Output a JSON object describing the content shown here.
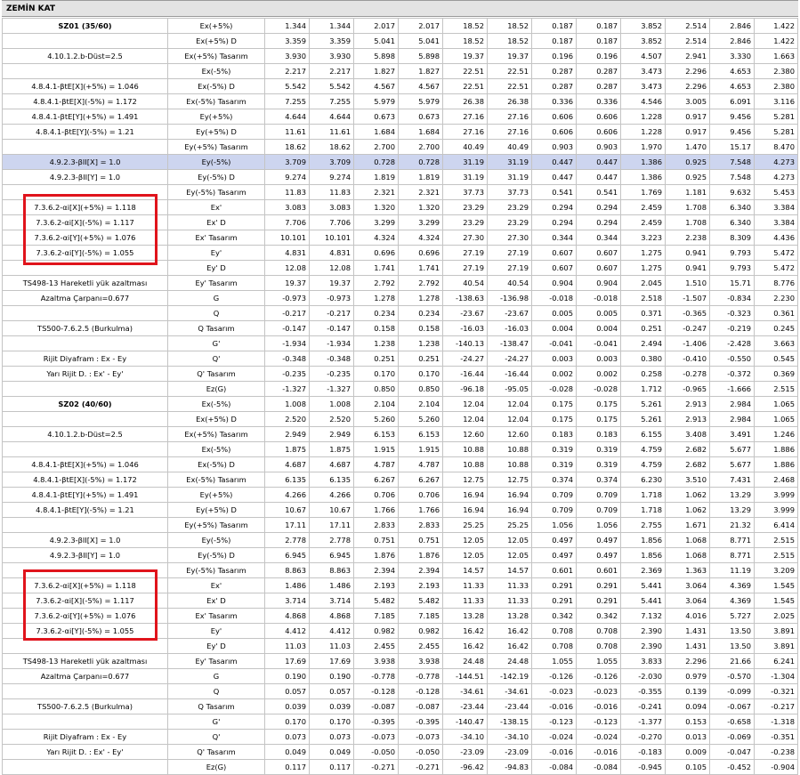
{
  "header": {
    "title": "ZEMİN KAT"
  },
  "rows": [
    {
      "label": "SZ01 (35/60)",
      "bold": true,
      "case": "Ex(+5%)",
      "v": [
        "1.344",
        "1.344",
        "2.017",
        "2.017",
        "18.52",
        "18.52",
        "0.187",
        "0.187",
        "3.852",
        "2.514",
        "2.846",
        "1.422"
      ]
    },
    {
      "label": "",
      "case": "Ex(+5%) D",
      "v": [
        "3.359",
        "3.359",
        "5.041",
        "5.041",
        "18.52",
        "18.52",
        "0.187",
        "0.187",
        "3.852",
        "2.514",
        "2.846",
        "1.422"
      ]
    },
    {
      "label": "4.10.1.2.b-Düst=2.5",
      "case": "Ex(+5%) Tasarım",
      "v": [
        "3.930",
        "3.930",
        "5.898",
        "5.898",
        "19.37",
        "19.37",
        "0.196",
        "0.196",
        "4.507",
        "2.941",
        "3.330",
        "1.663"
      ]
    },
    {
      "label": "",
      "case": "Ex(-5%)",
      "v": [
        "2.217",
        "2.217",
        "1.827",
        "1.827",
        "22.51",
        "22.51",
        "0.287",
        "0.287",
        "3.473",
        "2.296",
        "4.653",
        "2.380"
      ]
    },
    {
      "label": "4.8.4.1-βtE[X](+5%) = 1.046",
      "case": "Ex(-5%) D",
      "v": [
        "5.542",
        "5.542",
        "4.567",
        "4.567",
        "22.51",
        "22.51",
        "0.287",
        "0.287",
        "3.473",
        "2.296",
        "4.653",
        "2.380"
      ]
    },
    {
      "label": "4.8.4.1-βtE[X](-5%) = 1.172",
      "case": "Ex(-5%) Tasarım",
      "v": [
        "7.255",
        "7.255",
        "5.979",
        "5.979",
        "26.38",
        "26.38",
        "0.336",
        "0.336",
        "4.546",
        "3.005",
        "6.091",
        "3.116"
      ]
    },
    {
      "label": "4.8.4.1-βtE[Y](+5%) = 1.491",
      "case": "Ey(+5%)",
      "v": [
        "4.644",
        "4.644",
        "0.673",
        "0.673",
        "27.16",
        "27.16",
        "0.606",
        "0.606",
        "1.228",
        "0.917",
        "9.456",
        "5.281"
      ]
    },
    {
      "label": "4.8.4.1-βtE[Y](-5%) = 1.21",
      "case": "Ey(+5%) D",
      "v": [
        "11.61",
        "11.61",
        "1.684",
        "1.684",
        "27.16",
        "27.16",
        "0.606",
        "0.606",
        "1.228",
        "0.917",
        "9.456",
        "5.281"
      ]
    },
    {
      "label": "",
      "case": "Ey(+5%) Tasarım",
      "v": [
        "18.62",
        "18.62",
        "2.700",
        "2.700",
        "40.49",
        "40.49",
        "0.903",
        "0.903",
        "1.970",
        "1.470",
        "15.17",
        "8.470"
      ]
    },
    {
      "label": "4.9.2.3-βII[X] = 1.0",
      "hl": true,
      "case": "Ey(-5%)",
      "v": [
        "3.709",
        "3.709",
        "0.728",
        "0.728",
        "31.19",
        "31.19",
        "0.447",
        "0.447",
        "1.386",
        "0.925",
        "7.548",
        "4.273"
      ]
    },
    {
      "label": "4.9.2.3-βII[Y] = 1.0",
      "case": "Ey(-5%) D",
      "v": [
        "9.274",
        "9.274",
        "1.819",
        "1.819",
        "31.19",
        "31.19",
        "0.447",
        "0.447",
        "1.386",
        "0.925",
        "7.548",
        "4.273"
      ]
    },
    {
      "label": "",
      "case": "Ey(-5%) Tasarım",
      "v": [
        "11.83",
        "11.83",
        "2.321",
        "2.321",
        "37.73",
        "37.73",
        "0.541",
        "0.541",
        "1.769",
        "1.181",
        "9.632",
        "5.453"
      ]
    },
    {
      "label": "7.3.6.2-αi[X](+5%) = 1.118",
      "case": "Ex'",
      "v": [
        "3.083",
        "3.083",
        "1.320",
        "1.320",
        "23.29",
        "23.29",
        "0.294",
        "0.294",
        "2.459",
        "1.708",
        "6.340",
        "3.384"
      ]
    },
    {
      "label": "7.3.6.2-αi[X](-5%) = 1.117",
      "case": "Ex' D",
      "v": [
        "7.706",
        "7.706",
        "3.299",
        "3.299",
        "23.29",
        "23.29",
        "0.294",
        "0.294",
        "2.459",
        "1.708",
        "6.340",
        "3.384"
      ]
    },
    {
      "label": "7.3.6.2-αi[Y](+5%) = 1.076",
      "case": "Ex' Tasarım",
      "v": [
        "10.101",
        "10.101",
        "4.324",
        "4.324",
        "27.30",
        "27.30",
        "0.344",
        "0.344",
        "3.223",
        "2.238",
        "8.309",
        "4.436"
      ]
    },
    {
      "label": "7.3.6.2-αi[Y](-5%) = 1.055",
      "case": "Ey'",
      "v": [
        "4.831",
        "4.831",
        "0.696",
        "0.696",
        "27.19",
        "27.19",
        "0.607",
        "0.607",
        "1.275",
        "0.941",
        "9.793",
        "5.472"
      ]
    },
    {
      "label": "",
      "case": "Ey' D",
      "v": [
        "12.08",
        "12.08",
        "1.741",
        "1.741",
        "27.19",
        "27.19",
        "0.607",
        "0.607",
        "1.275",
        "0.941",
        "9.793",
        "5.472"
      ]
    },
    {
      "label": "TS498-13 Hareketli yük azaltması",
      "case": "Ey' Tasarım",
      "v": [
        "19.37",
        "19.37",
        "2.792",
        "2.792",
        "40.54",
        "40.54",
        "0.904",
        "0.904",
        "2.045",
        "1.510",
        "15.71",
        "8.776"
      ]
    },
    {
      "label": "Azaltma Çarpanı=0.677",
      "case": "G",
      "v": [
        "-0.973",
        "-0.973",
        "1.278",
        "1.278",
        "-138.63",
        "-136.98",
        "-0.018",
        "-0.018",
        "2.518",
        "-1.507",
        "-0.834",
        "2.230"
      ]
    },
    {
      "label": "",
      "case": "Q",
      "v": [
        "-0.217",
        "-0.217",
        "0.234",
        "0.234",
        "-23.67",
        "-23.67",
        "0.005",
        "0.005",
        "0.371",
        "-0.365",
        "-0.323",
        "0.361"
      ]
    },
    {
      "label": "TS500-7.6.2.5 (Burkulma)",
      "case": "Q Tasarım",
      "v": [
        "-0.147",
        "-0.147",
        "0.158",
        "0.158",
        "-16.03",
        "-16.03",
        "0.004",
        "0.004",
        "0.251",
        "-0.247",
        "-0.219",
        "0.245"
      ]
    },
    {
      "label": "",
      "case": "G'",
      "v": [
        "-1.934",
        "-1.934",
        "1.238",
        "1.238",
        "-140.13",
        "-138.47",
        "-0.041",
        "-0.041",
        "2.494",
        "-1.406",
        "-2.428",
        "3.663"
      ]
    },
    {
      "label": "Rijit Diyafram : Ex - Ey",
      "case": "Q'",
      "v": [
        "-0.348",
        "-0.348",
        "0.251",
        "0.251",
        "-24.27",
        "-24.27",
        "0.003",
        "0.003",
        "0.380",
        "-0.410",
        "-0.550",
        "0.545"
      ]
    },
    {
      "label": "Yarı Rijit D. : Ex' - Ey'",
      "case": "Q' Tasarım",
      "v": [
        "-0.235",
        "-0.235",
        "0.170",
        "0.170",
        "-16.44",
        "-16.44",
        "0.002",
        "0.002",
        "0.258",
        "-0.278",
        "-0.372",
        "0.369"
      ]
    },
    {
      "label": "",
      "case": "Ez(G)",
      "v": [
        "-1.327",
        "-1.327",
        "0.850",
        "0.850",
        "-96.18",
        "-95.05",
        "-0.028",
        "-0.028",
        "1.712",
        "-0.965",
        "-1.666",
        "2.515"
      ]
    },
    {
      "label": "SZ02 (40/60)",
      "bold": true,
      "sep": true,
      "case": "Ex(-5%)",
      "v": [
        "1.008",
        "1.008",
        "2.104",
        "2.104",
        "12.04",
        "12.04",
        "0.175",
        "0.175",
        "5.261",
        "2.913",
        "2.984",
        "1.065"
      ]
    },
    {
      "label": "",
      "case": "Ex(+5%) D",
      "v": [
        "2.520",
        "2.520",
        "5.260",
        "5.260",
        "12.04",
        "12.04",
        "0.175",
        "0.175",
        "5.261",
        "2.913",
        "2.984",
        "1.065"
      ]
    },
    {
      "label": "4.10.1.2.b-Düst=2.5",
      "case": "Ex(+5%) Tasarım",
      "v": [
        "2.949",
        "2.949",
        "6.153",
        "6.153",
        "12.60",
        "12.60",
        "0.183",
        "0.183",
        "6.155",
        "3.408",
        "3.491",
        "1.246"
      ]
    },
    {
      "label": "",
      "case": "Ex(-5%)",
      "v": [
        "1.875",
        "1.875",
        "1.915",
        "1.915",
        "10.88",
        "10.88",
        "0.319",
        "0.319",
        "4.759",
        "2.682",
        "5.677",
        "1.886"
      ]
    },
    {
      "label": "4.8.4.1-βtE[X](+5%) = 1.046",
      "case": "Ex(-5%) D",
      "v": [
        "4.687",
        "4.687",
        "4.787",
        "4.787",
        "10.88",
        "10.88",
        "0.319",
        "0.319",
        "4.759",
        "2.682",
        "5.677",
        "1.886"
      ]
    },
    {
      "label": "4.8.4.1-βtE[X](-5%) = 1.172",
      "case": "Ex(-5%) Tasarım",
      "v": [
        "6.135",
        "6.135",
        "6.267",
        "6.267",
        "12.75",
        "12.75",
        "0.374",
        "0.374",
        "6.230",
        "3.510",
        "7.431",
        "2.468"
      ]
    },
    {
      "label": "4.8.4.1-βtE[Y](+5%) = 1.491",
      "case": "Ey(+5%)",
      "v": [
        "4.266",
        "4.266",
        "0.706",
        "0.706",
        "16.94",
        "16.94",
        "0.709",
        "0.709",
        "1.718",
        "1.062",
        "13.29",
        "3.999"
      ]
    },
    {
      "label": "4.8.4.1-βtE[Y](-5%) = 1.21",
      "case": "Ey(+5%) D",
      "v": [
        "10.67",
        "10.67",
        "1.766",
        "1.766",
        "16.94",
        "16.94",
        "0.709",
        "0.709",
        "1.718",
        "1.062",
        "13.29",
        "3.999"
      ]
    },
    {
      "label": "",
      "case": "Ey(+5%) Tasarım",
      "v": [
        "17.11",
        "17.11",
        "2.833",
        "2.833",
        "25.25",
        "25.25",
        "1.056",
        "1.056",
        "2.755",
        "1.671",
        "21.32",
        "6.414"
      ]
    },
    {
      "label": "4.9.2.3-βII[X] = 1.0",
      "case": "Ey(-5%)",
      "v": [
        "2.778",
        "2.778",
        "0.751",
        "0.751",
        "12.05",
        "12.05",
        "0.497",
        "0.497",
        "1.856",
        "1.068",
        "8.771",
        "2.515"
      ]
    },
    {
      "label": "4.9.2.3-βII[Y] = 1.0",
      "case": "Ey(-5%) D",
      "v": [
        "6.945",
        "6.945",
        "1.876",
        "1.876",
        "12.05",
        "12.05",
        "0.497",
        "0.497",
        "1.856",
        "1.068",
        "8.771",
        "2.515"
      ]
    },
    {
      "label": "",
      "case": "Ey(-5%) Tasarım",
      "v": [
        "8.863",
        "8.863",
        "2.394",
        "2.394",
        "14.57",
        "14.57",
        "0.601",
        "0.601",
        "2.369",
        "1.363",
        "11.19",
        "3.209"
      ]
    },
    {
      "label": "7.3.6.2-αi[X](+5%) = 1.118",
      "case": "Ex'",
      "v": [
        "1.486",
        "1.486",
        "2.193",
        "2.193",
        "11.33",
        "11.33",
        "0.291",
        "0.291",
        "5.441",
        "3.064",
        "4.369",
        "1.545"
      ]
    },
    {
      "label": "7.3.6.2-αi[X](-5%) = 1.117",
      "case": "Ex' D",
      "v": [
        "3.714",
        "3.714",
        "5.482",
        "5.482",
        "11.33",
        "11.33",
        "0.291",
        "0.291",
        "5.441",
        "3.064",
        "4.369",
        "1.545"
      ]
    },
    {
      "label": "7.3.6.2-αi[Y](+5%) = 1.076",
      "case": "Ex' Tasarım",
      "v": [
        "4.868",
        "4.868",
        "7.185",
        "7.185",
        "13.28",
        "13.28",
        "0.342",
        "0.342",
        "7.132",
        "4.016",
        "5.727",
        "2.025"
      ]
    },
    {
      "label": "7.3.6.2-αi[Y](-5%) = 1.055",
      "case": "Ey'",
      "v": [
        "4.412",
        "4.412",
        "0.982",
        "0.982",
        "16.42",
        "16.42",
        "0.708",
        "0.708",
        "2.390",
        "1.431",
        "13.50",
        "3.891"
      ]
    },
    {
      "label": "",
      "case": "Ey' D",
      "v": [
        "11.03",
        "11.03",
        "2.455",
        "2.455",
        "16.42",
        "16.42",
        "0.708",
        "0.708",
        "2.390",
        "1.431",
        "13.50",
        "3.891"
      ]
    },
    {
      "label": "TS498-13 Hareketli yük azaltması",
      "case": "Ey' Tasarım",
      "v": [
        "17.69",
        "17.69",
        "3.938",
        "3.938",
        "24.48",
        "24.48",
        "1.055",
        "1.055",
        "3.833",
        "2.296",
        "21.66",
        "6.241"
      ]
    },
    {
      "label": "Azaltma Çarpanı=0.677",
      "case": "G",
      "v": [
        "0.190",
        "0.190",
        "-0.778",
        "-0.778",
        "-144.51",
        "-142.19",
        "-0.126",
        "-0.126",
        "-2.030",
        "0.979",
        "-0.570",
        "-1.304"
      ]
    },
    {
      "label": "",
      "case": "Q",
      "v": [
        "0.057",
        "0.057",
        "-0.128",
        "-0.128",
        "-34.61",
        "-34.61",
        "-0.023",
        "-0.023",
        "-0.355",
        "0.139",
        "-0.099",
        "-0.321"
      ]
    },
    {
      "label": "TS500-7.6.2.5 (Burkulma)",
      "case": "Q Tasarım",
      "v": [
        "0.039",
        "0.039",
        "-0.087",
        "-0.087",
        "-23.44",
        "-23.44",
        "-0.016",
        "-0.016",
        "-0.241",
        "0.094",
        "-0.067",
        "-0.217"
      ]
    },
    {
      "label": "",
      "case": "G'",
      "v": [
        "0.170",
        "0.170",
        "-0.395",
        "-0.395",
        "-140.47",
        "-138.15",
        "-0.123",
        "-0.123",
        "-1.377",
        "0.153",
        "-0.658",
        "-1.318"
      ]
    },
    {
      "label": "Rijit Diyafram : Ex - Ey",
      "case": "Q'",
      "v": [
        "0.073",
        "0.073",
        "-0.073",
        "-0.073",
        "-34.10",
        "-34.10",
        "-0.024",
        "-0.024",
        "-0.270",
        "0.013",
        "-0.069",
        "-0.351"
      ]
    },
    {
      "label": "Yarı Rijit D. : Ex' - Ey'",
      "case": "Q' Tasarım",
      "v": [
        "0.049",
        "0.049",
        "-0.050",
        "-0.050",
        "-23.09",
        "-23.09",
        "-0.016",
        "-0.016",
        "-0.183",
        "0.009",
        "-0.047",
        "-0.238"
      ]
    },
    {
      "label": "",
      "case": "Ez(G)",
      "v": [
        "0.117",
        "0.117",
        "-0.271",
        "-0.271",
        "-96.42",
        "-94.83",
        "-0.084",
        "-0.084",
        "-0.945",
        "0.105",
        "-0.452",
        "-0.904"
      ]
    }
  ],
  "colors": {
    "highlight_row": "#cdd5ef",
    "red_box": "#e0141c",
    "header_bg": "#e3e3e3"
  }
}
